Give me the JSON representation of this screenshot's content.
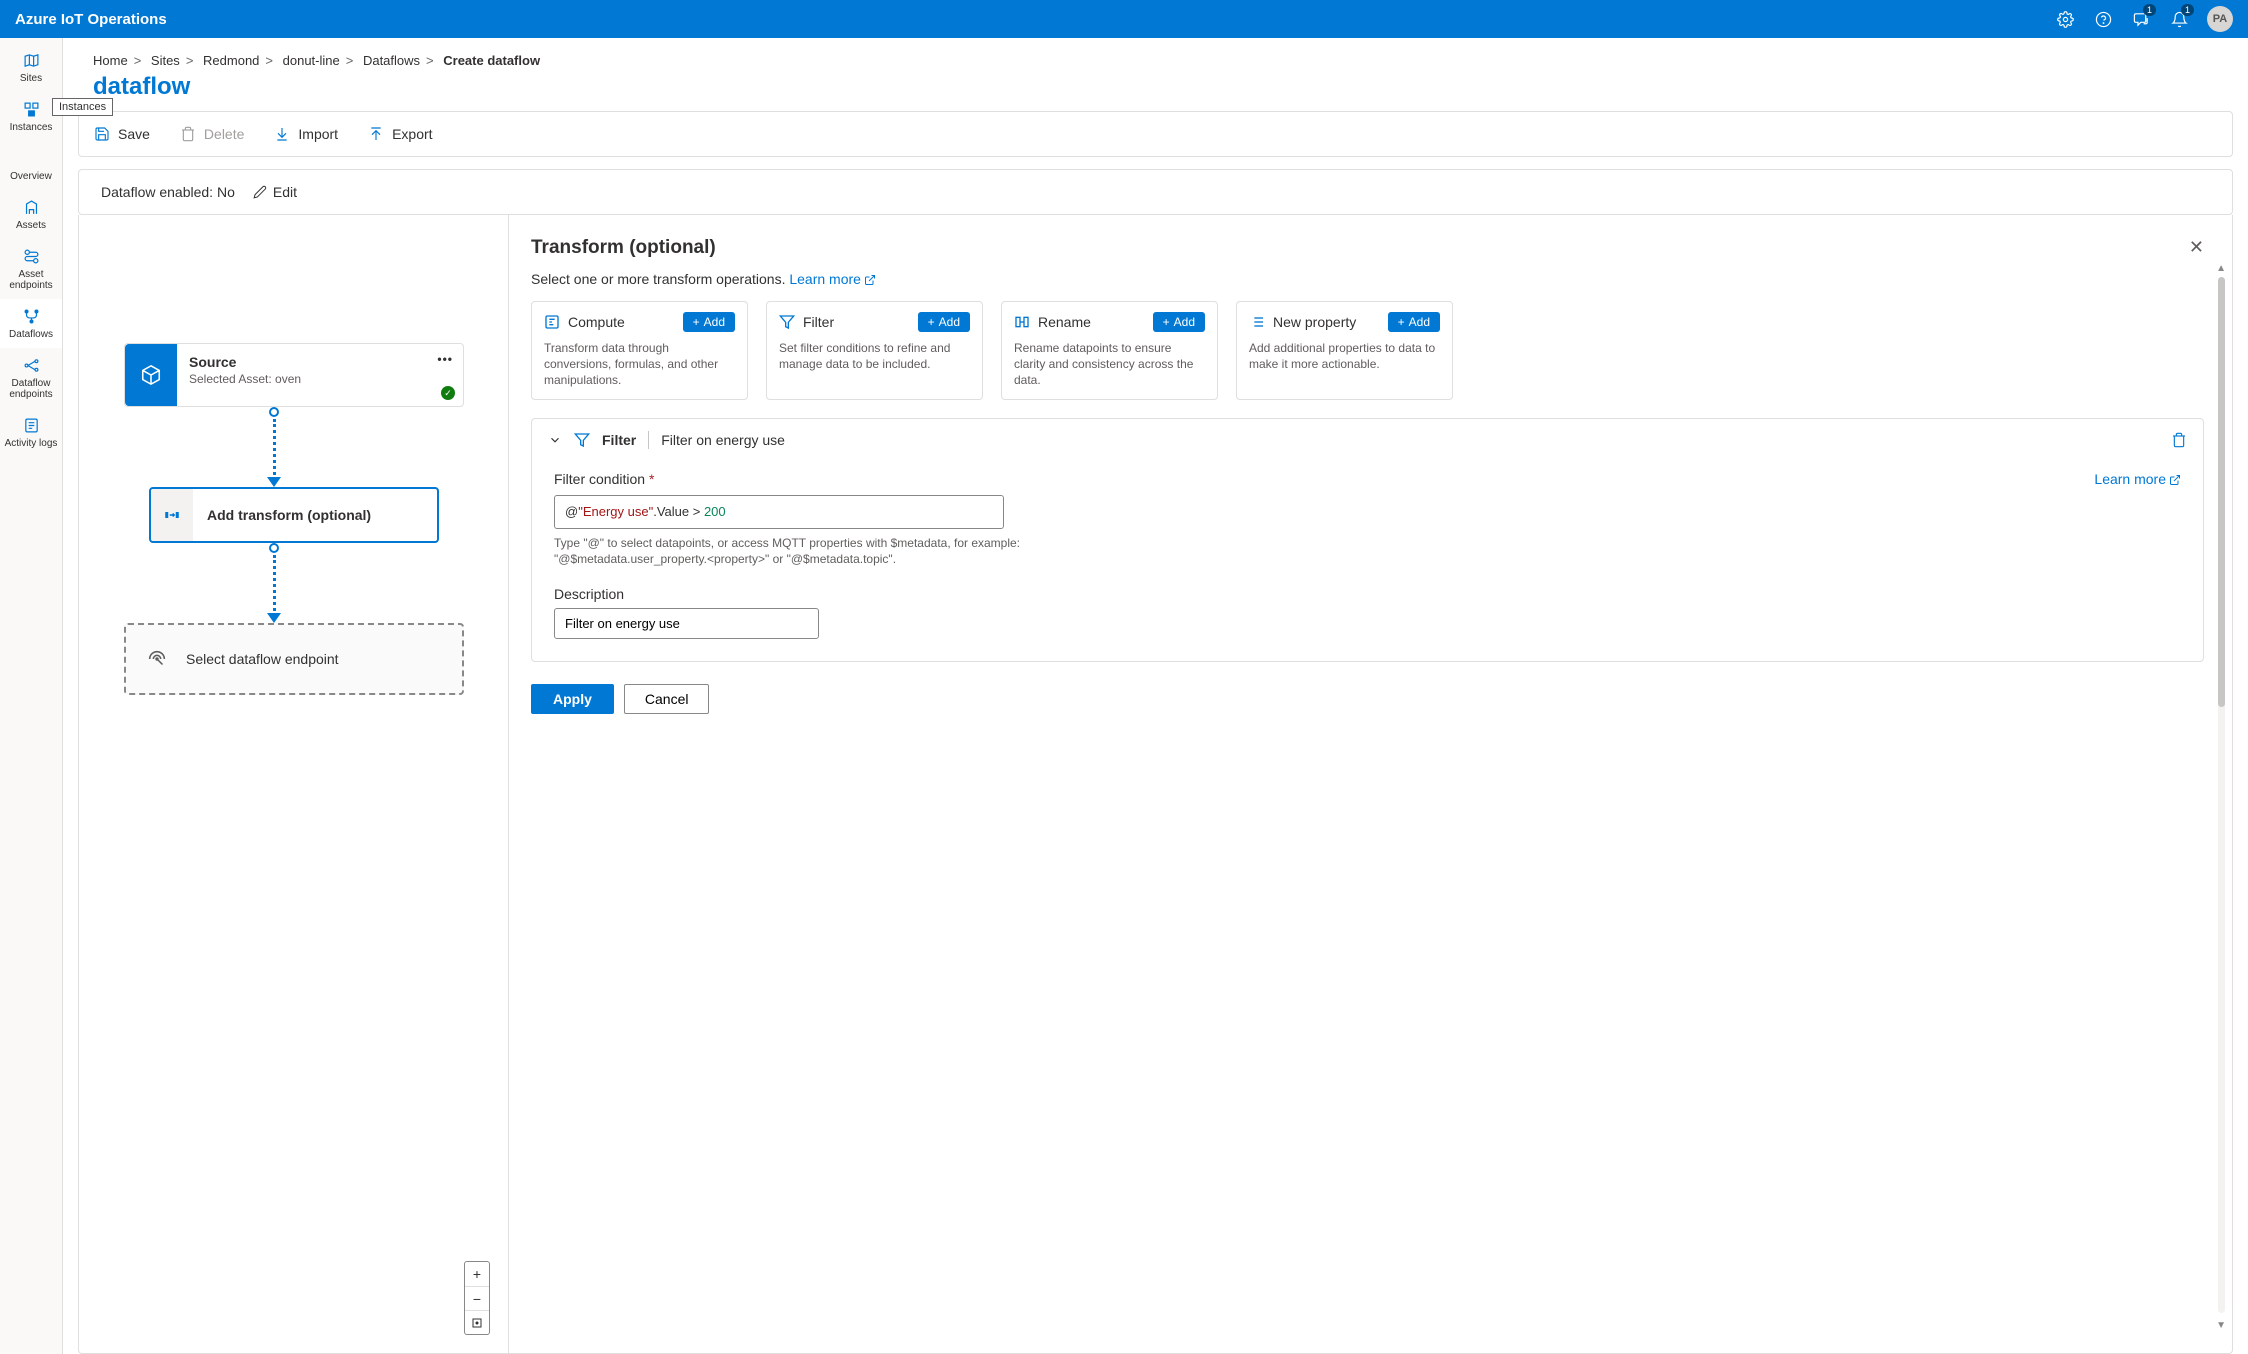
{
  "header": {
    "title": "Azure IoT Operations",
    "badge1": "1",
    "badge2": "1",
    "avatar": "PA"
  },
  "rail": {
    "sites": "Sites",
    "instances": "Instances",
    "instances_tooltip": "Instances",
    "overview": "Overview",
    "assets": "Assets",
    "asset_endpoints": "Asset endpoints",
    "dataflows": "Dataflows",
    "dataflow_endpoints": "Dataflow endpoints",
    "activity_logs": "Activity logs"
  },
  "breadcrumb": {
    "home": "Home",
    "sites": "Sites",
    "redmond": "Redmond",
    "donut": "donut-line",
    "dataflows": "Dataflows",
    "current": "Create dataflow"
  },
  "page": {
    "title": "dataflow"
  },
  "toolbar": {
    "save": "Save",
    "delete": "Delete",
    "import": "Import",
    "export": "Export"
  },
  "status": {
    "label": "Dataflow enabled: No",
    "edit": "Edit"
  },
  "canvas": {
    "source_title": "Source",
    "source_sub": "Selected Asset: oven",
    "transform_label": "Add transform (optional)",
    "dest_label": "Select dataflow endpoint"
  },
  "panel": {
    "title": "Transform (optional)",
    "subtitle": "Select one or more transform operations. ",
    "learn_more": "Learn more",
    "cards": {
      "compute": {
        "title": "Compute",
        "add": "Add",
        "desc": "Transform data through conversions, formulas, and other manipulations."
      },
      "filter": {
        "title": "Filter",
        "add": "Add",
        "desc": "Set filter conditions to refine and manage data to be included."
      },
      "rename": {
        "title": "Rename",
        "add": "Add",
        "desc": "Rename datapoints to ensure clarity and consistency across the data."
      },
      "newprop": {
        "title": "New property",
        "add": "Add",
        "desc": "Add additional properties to data to make it more actionable."
      }
    },
    "filter_block": {
      "head_title": "Filter",
      "head_sub": "Filter on energy use",
      "cond_label": "Filter condition",
      "learn_more": "Learn more",
      "code_at": "@",
      "code_str": "\"Energy use\"",
      "code_prop": ".Value",
      "code_op": " > ",
      "code_num": "200",
      "hint": "Type \"@\" to select datapoints, or access MQTT properties with $metadata, for example: \"@$metadata.user_property.<property>\" or \"@$metadata.topic\".",
      "desc_label": "Description",
      "desc_value": "Filter on energy use"
    },
    "apply": "Apply",
    "cancel": "Cancel"
  }
}
